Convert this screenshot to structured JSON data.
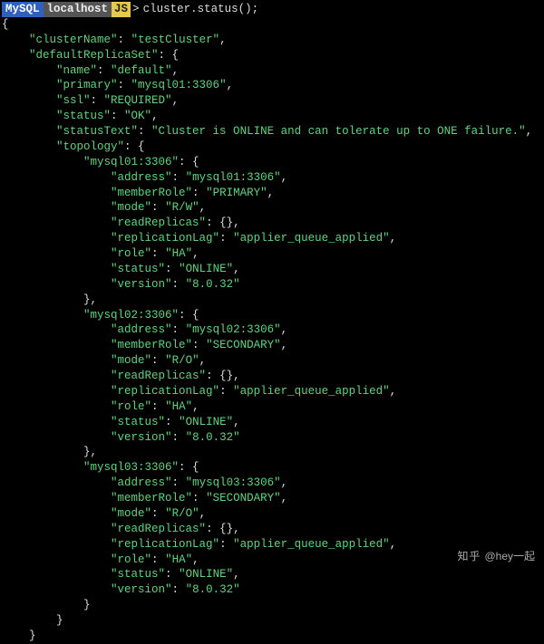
{
  "prompt": {
    "badge_mysql": " MySQL ",
    "badge_host": " localhost",
    "badge_js": "JS",
    "chevron": ">",
    "command": "cluster.status();"
  },
  "json_output": {
    "clusterName": "testCluster",
    "defaultReplicaSet": {
      "name": "default",
      "primary": "mysql01:3306",
      "ssl": "REQUIRED",
      "status": "OK",
      "statusText": "Cluster is ONLINE and can tolerate up to ONE failure.",
      "topology": {
        "mysql01:3306": {
          "address": "mysql01:3306",
          "memberRole": "PRIMARY",
          "mode": "R/W",
          "readReplicas": {},
          "replicationLag": "applier_queue_applied",
          "role": "HA",
          "status": "ONLINE",
          "version": "8.0.32"
        },
        "mysql02:3306": {
          "address": "mysql02:3306",
          "memberRole": "SECONDARY",
          "mode": "R/O",
          "readReplicas": {},
          "replicationLag": "applier_queue_applied",
          "role": "HA",
          "status": "ONLINE",
          "version": "8.0.32"
        },
        "mysql03:3306": {
          "address": "mysql03:3306",
          "memberRole": "SECONDARY",
          "mode": "R/O",
          "readReplicas": {},
          "replicationLag": "applier_queue_applied",
          "role": "HA",
          "status": "ONLINE",
          "version": "8.0.32"
        }
      }
    }
  },
  "watermark": {
    "site": "知乎",
    "handle": "@hey一起"
  }
}
